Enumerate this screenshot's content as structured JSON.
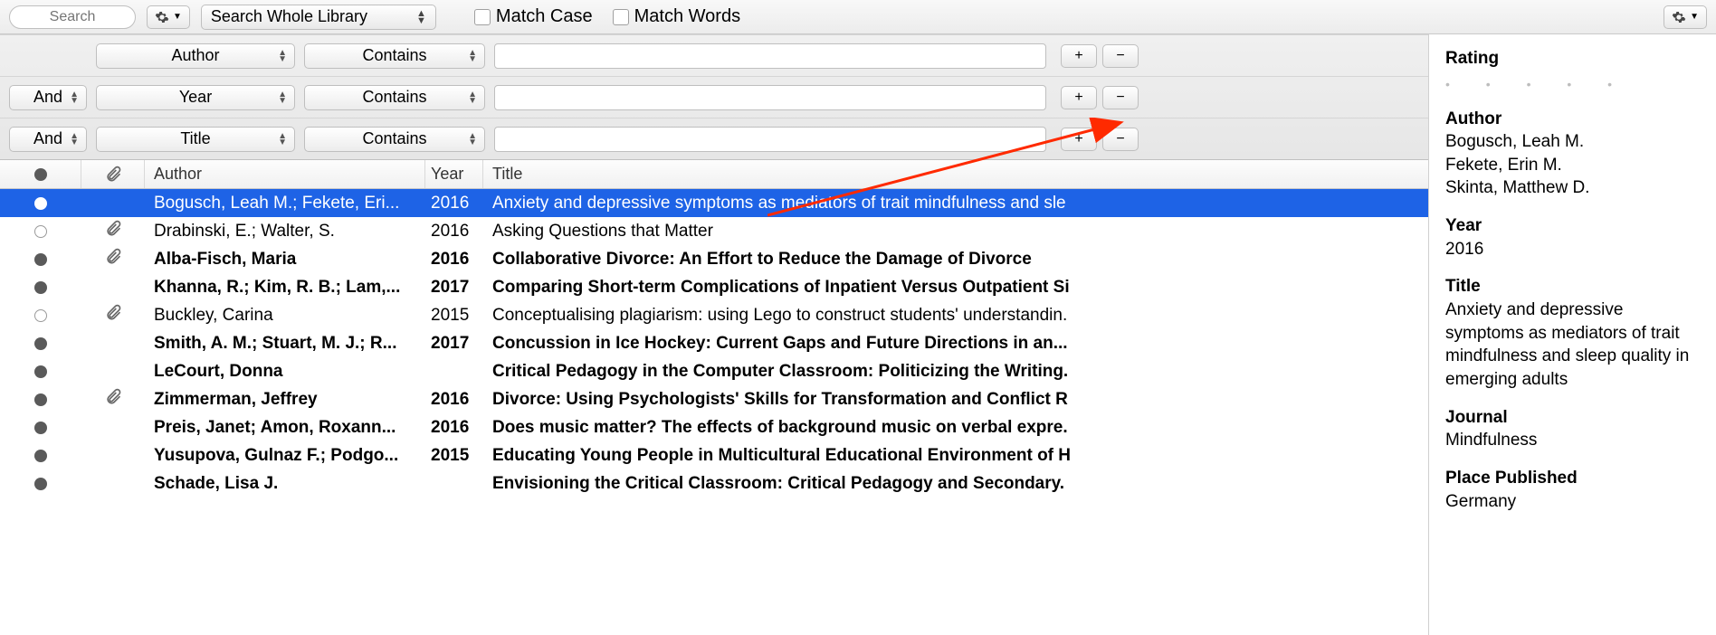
{
  "toolbar": {
    "search_placeholder": "Search",
    "scope": "Search Whole Library",
    "match_case": "Match Case",
    "match_words": "Match Words"
  },
  "filters": [
    {
      "bool": "",
      "field": "Author",
      "cond": "Contains",
      "value": ""
    },
    {
      "bool": "And",
      "field": "Year",
      "cond": "Contains",
      "value": ""
    },
    {
      "bool": "And",
      "field": "Title",
      "cond": "Contains",
      "value": ""
    }
  ],
  "columns": {
    "author": "Author",
    "year": "Year",
    "title": "Title"
  },
  "rows": [
    {
      "sel": true,
      "unread": false,
      "dot": "open",
      "clip": false,
      "author": "Bogusch, Leah M.; Fekete, Eri...",
      "year": "2016",
      "title": "Anxiety and depressive symptoms as mediators of trait mindfulness and sle"
    },
    {
      "sel": false,
      "unread": false,
      "dot": "open",
      "clip": true,
      "author": "Drabinski, E.; Walter, S.",
      "year": "2016",
      "title": "Asking Questions that Matter"
    },
    {
      "sel": false,
      "unread": true,
      "dot": "read",
      "clip": true,
      "author": "Alba-Fisch, Maria",
      "year": "2016",
      "title": "Collaborative Divorce: An Effort to Reduce the Damage of Divorce"
    },
    {
      "sel": false,
      "unread": true,
      "dot": "read",
      "clip": false,
      "author": "Khanna, R.; Kim, R. B.; Lam,...",
      "year": "2017",
      "title": "Comparing Short-term Complications of Inpatient Versus Outpatient Si"
    },
    {
      "sel": false,
      "unread": false,
      "dot": "open",
      "clip": true,
      "author": "Buckley, Carina",
      "year": "2015",
      "title": "Conceptualising plagiarism: using Lego to construct students' understandin."
    },
    {
      "sel": false,
      "unread": true,
      "dot": "read",
      "clip": false,
      "author": "Smith, A. M.; Stuart, M. J.; R...",
      "year": "2017",
      "title": "Concussion in Ice Hockey: Current Gaps and Future Directions in an..."
    },
    {
      "sel": false,
      "unread": true,
      "dot": "read",
      "clip": false,
      "author": "LeCourt, Donna",
      "year": "",
      "title": "Critical Pedagogy in the Computer Classroom: Politicizing the Writing."
    },
    {
      "sel": false,
      "unread": true,
      "dot": "read",
      "clip": true,
      "author": "Zimmerman, Jeffrey",
      "year": "2016",
      "title": "Divorce: Using Psychologists' Skills for Transformation and Conflict R"
    },
    {
      "sel": false,
      "unread": true,
      "dot": "read",
      "clip": false,
      "author": "Preis, Janet; Amon, Roxann...",
      "year": "2016",
      "title": "Does music matter? The effects of background music on verbal expre."
    },
    {
      "sel": false,
      "unread": true,
      "dot": "read",
      "clip": false,
      "author": "Yusupova, Gulnaz F.; Podgo...",
      "year": "2015",
      "title": "Educating Young People in Multicultural Educational Environment of H"
    },
    {
      "sel": false,
      "unread": true,
      "dot": "read",
      "clip": false,
      "author": "Schade, Lisa J.",
      "year": "",
      "title": "Envisioning the Critical Classroom: Critical Pedagogy and Secondary."
    }
  ],
  "details": {
    "rating_label": "Rating",
    "author_label": "Author",
    "authors": [
      "Bogusch, Leah M.",
      "Fekete, Erin M.",
      "Skinta, Matthew D."
    ],
    "year_label": "Year",
    "year": "2016",
    "title_label": "Title",
    "title": "Anxiety and depressive symptoms as mediators of trait mindfulness and sleep quality in emerging adults",
    "journal_label": "Journal",
    "journal": "Mindfulness",
    "place_label": "Place Published",
    "place": "Germany"
  },
  "glyph": {
    "plus": "+",
    "minus": "−",
    "dots": "•    •    •    •    •"
  }
}
